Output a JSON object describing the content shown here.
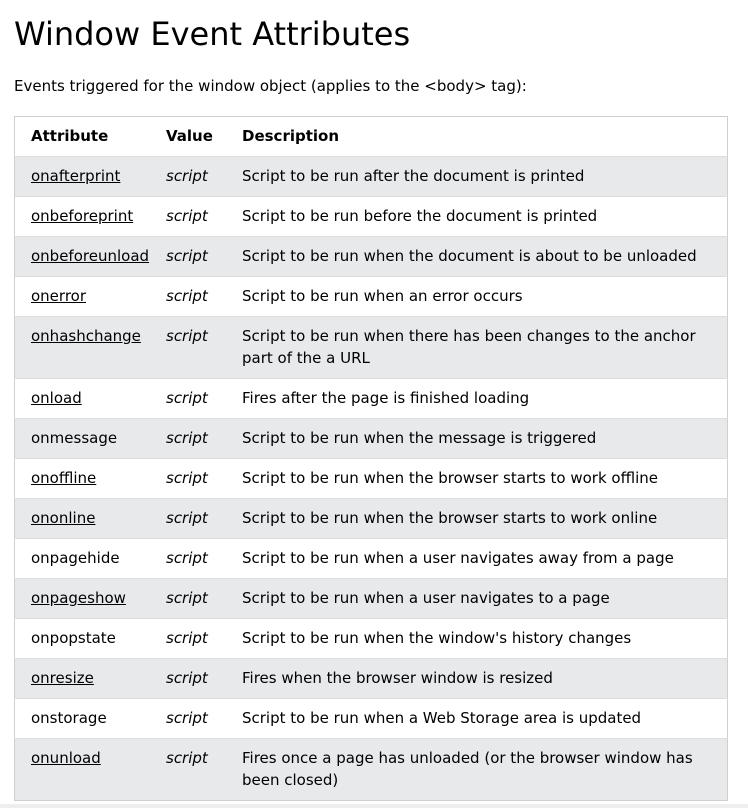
{
  "heading": "Window Event Attributes",
  "intro": "Events triggered for the window object (applies to the <body> tag):",
  "table": {
    "headers": [
      "Attribute",
      "Value",
      "Description"
    ],
    "rows": [
      {
        "attribute": "onafterprint",
        "linked": true,
        "value": "script",
        "description": "Script to be run after the document is printed"
      },
      {
        "attribute": "onbeforeprint",
        "linked": true,
        "value": "script",
        "description": "Script to be run before the document is printed"
      },
      {
        "attribute": "onbeforeunload",
        "linked": true,
        "value": "script",
        "description": "Script to be run when the document is about to be unloaded"
      },
      {
        "attribute": "onerror",
        "linked": true,
        "value": "script",
        "description": "Script to be run when an error occurs"
      },
      {
        "attribute": "onhashchange",
        "linked": true,
        "value": "script",
        "description": "Script to be run when there has been changes to the anchor part of the a URL"
      },
      {
        "attribute": "onload",
        "linked": true,
        "value": "script",
        "description": "Fires after the page is finished loading"
      },
      {
        "attribute": "onmessage",
        "linked": false,
        "value": "script",
        "description": "Script to be run when the message is triggered"
      },
      {
        "attribute": "onoffline",
        "linked": true,
        "value": "script",
        "description": "Script to be run when the browser starts to work offline"
      },
      {
        "attribute": "ononline",
        "linked": true,
        "value": "script",
        "description": "Script to be run when the browser starts to work online"
      },
      {
        "attribute": "onpagehide",
        "linked": false,
        "value": "script",
        "description": "Script to be run when a user navigates away from a page"
      },
      {
        "attribute": "onpageshow",
        "linked": true,
        "value": "script",
        "description": "Script to be run when a user navigates to a page"
      },
      {
        "attribute": "onpopstate",
        "linked": false,
        "value": "script",
        "description": "Script to be run when the window's history changes"
      },
      {
        "attribute": "onresize",
        "linked": true,
        "value": "script",
        "description": "Fires when the browser window is resized"
      },
      {
        "attribute": "onstorage",
        "linked": false,
        "value": "script",
        "description": "Script to be run when a Web Storage area is updated"
      },
      {
        "attribute": "onunload",
        "linked": true,
        "value": "script",
        "description": "Fires once a page has unloaded (or the browser window has been closed)"
      }
    ]
  },
  "colors": {
    "stripe": "#e7e9eb",
    "border": "#cfcfcf"
  }
}
